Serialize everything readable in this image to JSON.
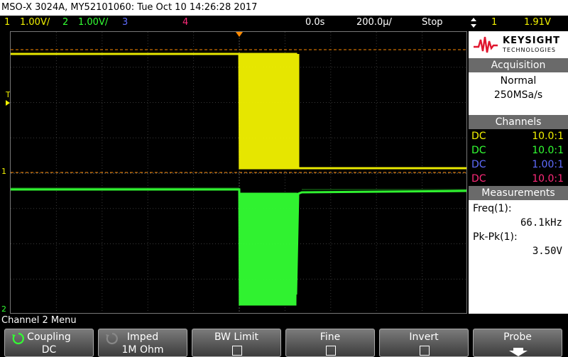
{
  "title": "MSO-X 3024A, MY52101060: Tue Oct 10 14:26:28 2017",
  "status": {
    "ch1_num": "1",
    "ch1_scale": "1.00V/",
    "ch2_num": "2",
    "ch2_scale": "1.00V/",
    "ch3_num": "3",
    "ch4_num": "4",
    "time_delay": "0.0s",
    "time_scale": "200.0µ/",
    "run_state": "Stop",
    "trig_icon": "trigger-edge-icon",
    "trig_source": "1",
    "trig_level": "1.91V"
  },
  "colors": {
    "ch1": "#f2f200",
    "ch2": "#33ff33",
    "ch3": "#5f6cff",
    "ch4": "#ff2a7a",
    "trigger_marker": "#ff8a00"
  },
  "screen_markers": {
    "trigger_marker_label": "T",
    "ch1_ground_label": "1",
    "ch2_ground_label": "2"
  },
  "panel": {
    "brand": "KEYSIGHT",
    "brand_sub": "TECHNOLOGIES",
    "acq_header": "Acquisition",
    "acq_mode": "Normal",
    "acq_rate": "250MSa/s",
    "channels_header": "Channels",
    "channels": [
      {
        "coupling": "DC",
        "ratio": "10.0:1"
      },
      {
        "coupling": "DC",
        "ratio": "10.0:1"
      },
      {
        "coupling": "DC",
        "ratio": "1.00:1"
      },
      {
        "coupling": "DC",
        "ratio": "10.0:1"
      }
    ],
    "meas_header": "Measurements",
    "meas": [
      {
        "label": "Freq(1):",
        "value": "66.1kHz"
      },
      {
        "label": "Pk-Pk(1):",
        "value": "3.50V"
      }
    ]
  },
  "menu_title": "Channel 2 Menu",
  "softkeys": [
    {
      "label": "Coupling",
      "value": "DC"
    },
    {
      "label": "Imped",
      "value": "1M Ohm"
    },
    {
      "label": "BW Limit",
      "value": ""
    },
    {
      "label": "Fine",
      "value": ""
    },
    {
      "label": "Invert",
      "value": ""
    },
    {
      "label": "Probe",
      "value": ""
    }
  ]
}
